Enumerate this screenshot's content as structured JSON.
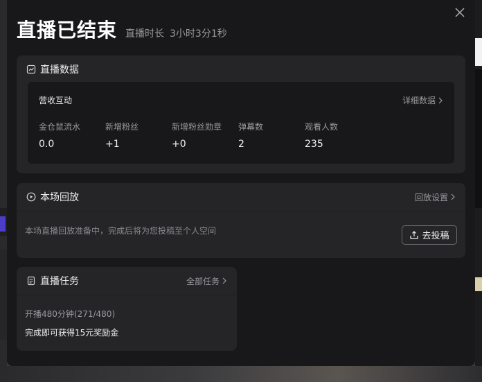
{
  "dialog": {
    "title": "直播已结束",
    "duration_label": "直播时长",
    "duration_value": "3小时3分1秒"
  },
  "live_data": {
    "section_title": "直播数据",
    "sub_title": "营收互动",
    "detail_link": "详细数据",
    "stats": [
      {
        "label": "金仓鼠流水",
        "value": "0.0"
      },
      {
        "label": "新增粉丝",
        "value": "+1"
      },
      {
        "label": "新增粉丝勋章",
        "value": "+0"
      },
      {
        "label": "弹幕数",
        "value": "2"
      },
      {
        "label": "观看人数",
        "value": "235"
      }
    ]
  },
  "replay": {
    "section_title": "本场回放",
    "settings_link": "回放设置",
    "description": "本场直播回放准备中，完成后将为您投稿至个人空间",
    "submit_button": "去投稿"
  },
  "tasks": {
    "section_title": "直播任务",
    "all_link": "全部任务",
    "task_name": "开播480分钟(271/480)",
    "task_reward": "完成即可获得15元奖励金"
  },
  "icons": {
    "close": "close-icon",
    "chart": "chart-icon",
    "replay": "play-circle-icon",
    "task": "document-icon",
    "upload": "upload-icon",
    "chevron": "chevron-right-icon"
  }
}
